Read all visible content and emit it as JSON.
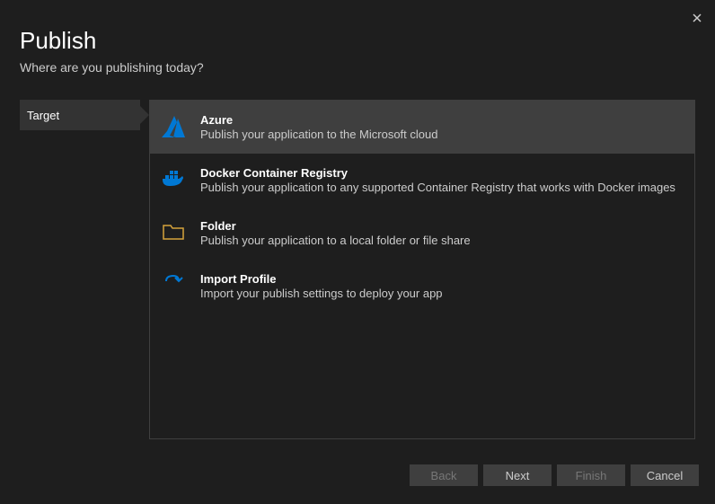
{
  "header": {
    "title": "Publish",
    "subtitle": "Where are you publishing today?"
  },
  "sidebar": {
    "items": [
      {
        "label": "Target",
        "active": true
      }
    ]
  },
  "options": [
    {
      "id": "azure",
      "title": "Azure",
      "desc": "Publish your application to the Microsoft cloud",
      "selected": true
    },
    {
      "id": "docker",
      "title": "Docker Container Registry",
      "desc": "Publish your application to any supported Container Registry that works with Docker images",
      "selected": false
    },
    {
      "id": "folder",
      "title": "Folder",
      "desc": "Publish your application to a local folder or file share",
      "selected": false
    },
    {
      "id": "import",
      "title": "Import Profile",
      "desc": "Import your publish settings to deploy your app",
      "selected": false
    }
  ],
  "footer": {
    "back": "Back",
    "next": "Next",
    "finish": "Finish",
    "cancel": "Cancel"
  },
  "colors": {
    "accent": "#0078d4",
    "folder_icon": "#d6a33c"
  }
}
